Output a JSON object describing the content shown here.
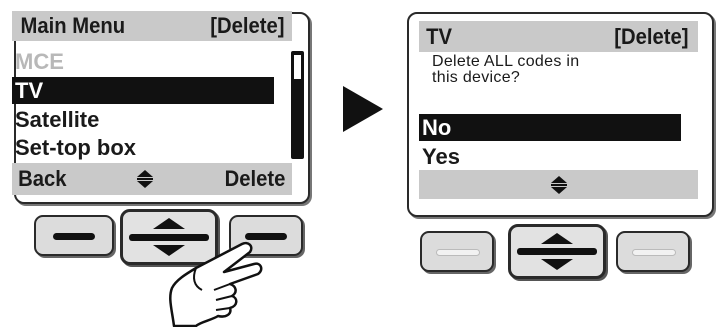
{
  "left_screen": {
    "title": "Main Menu",
    "title_action": "[Delete]",
    "items": [
      "MCE",
      "TV",
      "Satellite",
      "Set-top box"
    ],
    "selected_item": "TV",
    "softkeys": {
      "left": "Back",
      "right": "Delete"
    }
  },
  "right_screen": {
    "title": "TV",
    "title_action": "[Delete]",
    "question_line1": "Delete ALL codes in",
    "question_line2": "this device?",
    "options": [
      "No",
      "Yes"
    ],
    "selected_option": "No"
  },
  "icons": {
    "scroll_updown": "up-down-arrows-icon",
    "transition_arrow": "play-arrow-icon",
    "finger": "pointing-hand-icon"
  },
  "colors": {
    "bar_gray": "#c9c9c9",
    "selection": "#111111",
    "dim_text": "#b8b8b8"
  }
}
